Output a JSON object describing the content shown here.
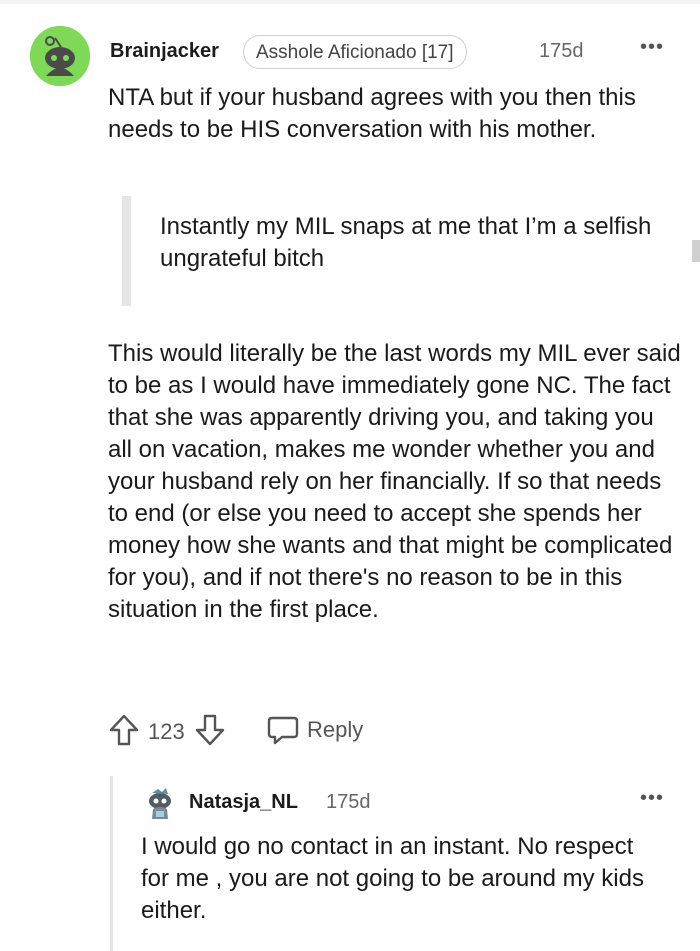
{
  "comment": {
    "author": "Brainjacker",
    "flair": "Asshole Aficionado [17]",
    "age": "175d",
    "more": "•••",
    "text_intro": "NTA but if your husband agrees with you then this needs to be HIS conversation with his mother.",
    "quote": "Instantly my MIL snaps at me that I’m a selfish ungrateful bitch",
    "text_body": "This would literally be the last words my MIL ever said to be as I would have immediately gone NC. The fact that she was apparently driving you, and taking you all on vacation, makes me wonder whether you and your husband rely on her financially. If so that needs to end (or else you need to accept she spends her money how she wants and that might be complicated for you), and if not there's no reason to be in this situation in the first place.",
    "score": "123",
    "reply_label": "Reply",
    "avatar_color": "#7ed957"
  },
  "reply_comment": {
    "author": "Natasja_NL",
    "age": "175d",
    "more": "•••",
    "text": "I would go no contact in an instant. No respect for me , you are not going to be around my kids either."
  }
}
